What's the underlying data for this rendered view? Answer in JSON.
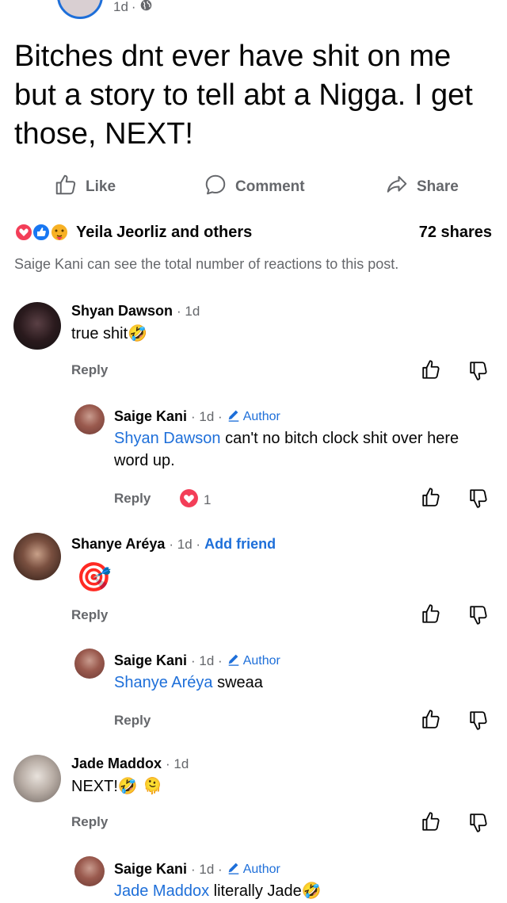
{
  "header": {
    "time": "1d",
    "dot": "·"
  },
  "post": {
    "text": "Bitches dnt ever have shit on me but a story to tell abt a Nigga. I get those, NEXT!"
  },
  "actions": {
    "like": "Like",
    "comment": "Comment",
    "share": "Share"
  },
  "reactions": {
    "summary": "Yeila Jeorliz and others",
    "shares": "72 shares"
  },
  "notice": "Saige Kani can see the total number of reactions to this post.",
  "labels": {
    "reply": "Reply",
    "author": "Author",
    "add_friend": "Add friend",
    "dot_time": "· 1d ·",
    "time_only": "· 1d"
  },
  "comments": [
    {
      "name": "Shyan Dawson",
      "time": "· 1d",
      "text": "true shit",
      "emoji": "🤣",
      "reply": {
        "name": "Saige Kani",
        "mention": "Shyan Dawson",
        "text": " can't no bitch clock shit over here word up.",
        "reactions": "1"
      }
    },
    {
      "name": "Shanye Aréya",
      "time": "· 1d ·",
      "emoji": "🎯",
      "reply": {
        "name": "Saige Kani",
        "mention": "Shanye Aréya",
        "text": " sweaa"
      }
    },
    {
      "name": "Jade Maddox",
      "time": "· 1d",
      "text": "NEXT!",
      "emoji": "🤣 🫠",
      "reply": {
        "name": "Saige Kani",
        "mention": "Jade Maddox",
        "text": " literally Jade",
        "emoji": "🤣"
      }
    }
  ]
}
